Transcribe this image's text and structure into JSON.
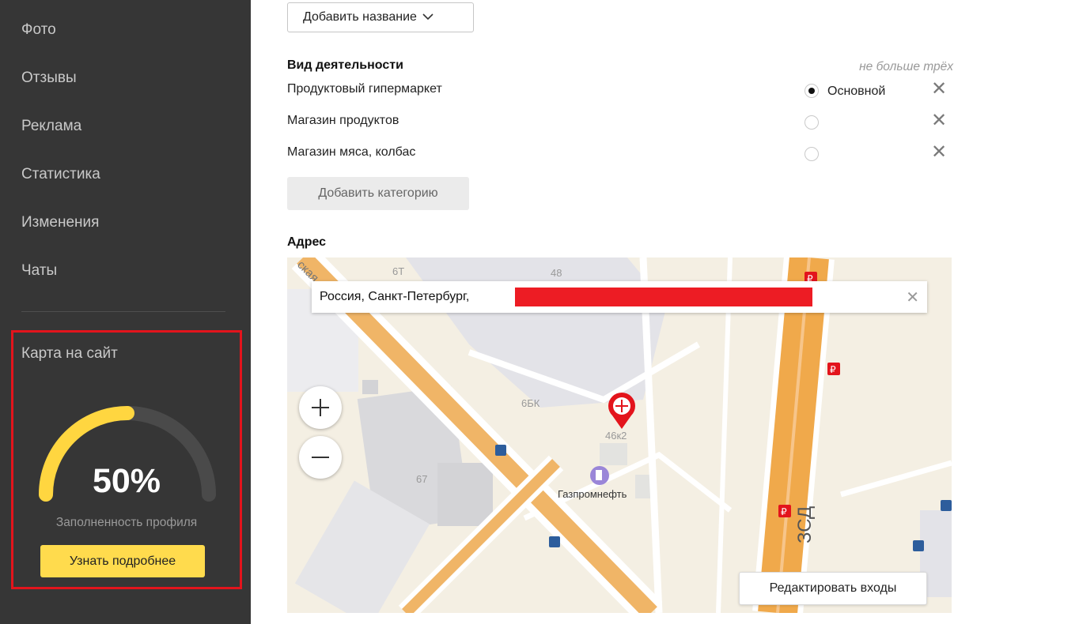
{
  "sidebar": {
    "items": [
      {
        "label": "Фото"
      },
      {
        "label": "Отзывы"
      },
      {
        "label": "Реклама"
      },
      {
        "label": "Статистика"
      },
      {
        "label": "Изменения"
      },
      {
        "label": "Чаты"
      }
    ],
    "promo": {
      "title": "Карта на сайт",
      "completeness_value": "50%",
      "completeness_fraction": 0.5,
      "caption": "Заполненность профиля",
      "button": "Узнать подробнее"
    }
  },
  "main": {
    "add_name_button": "Добавить название",
    "activity": {
      "title": "Вид деятельности",
      "hint": "не больше трёх",
      "categories": [
        {
          "name": "Продуктовый гипермаркет",
          "primary": true
        },
        {
          "name": "Магазин продуктов",
          "primary": false
        },
        {
          "name": "Магазин мяса, колбас",
          "primary": false
        }
      ],
      "primary_label": "Основной",
      "add_category_button": "Добавить категорию"
    },
    "address": {
      "title": "Адрес",
      "value": "Россия, Санкт-Петербург,",
      "map_labels": {
        "b1": "6Т",
        "b2": "48",
        "b3": "6БК",
        "b4": "46к2",
        "b5": "67",
        "poi": "Газпромнефть",
        "road": "ЗСД",
        "street": "ская"
      },
      "edit_entrances_button": "Редактировать входы"
    }
  },
  "colors": {
    "sidebar_bg": "#363636",
    "accent_yellow": "#ffdb4d",
    "gauge_fill": "#ffd640",
    "highlight_red": "#e3141c",
    "road_orange": "#f0a94b"
  },
  "icons": [
    "chevron-down-icon",
    "close-icon",
    "plus-icon",
    "minus-icon",
    "map-pin-move-icon",
    "fuel-icon",
    "metro-icon",
    "parking-icon"
  ]
}
